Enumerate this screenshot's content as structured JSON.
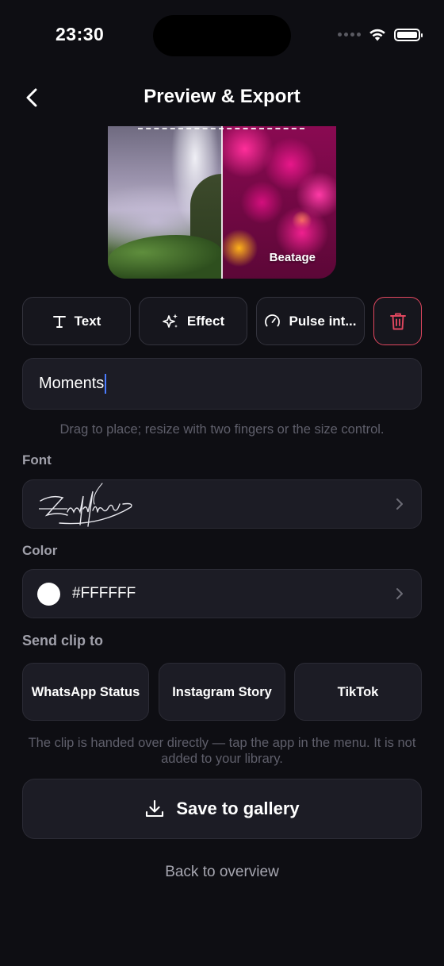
{
  "status_bar": {
    "time": "23:30"
  },
  "header": {
    "title": "Preview & Export"
  },
  "preview": {
    "watermark": "Beatage"
  },
  "tools": {
    "text_label": "Text",
    "effect_label": "Effect",
    "pulse_label": "Pulse int..."
  },
  "text_input": {
    "value": "Moments"
  },
  "text_hint": "Drag to place; resize with two fingers or the size control.",
  "font": {
    "label": "Font",
    "value": "Zapfino"
  },
  "color": {
    "label": "Color",
    "value": "#FFFFFF",
    "swatch": "#FFFFFF"
  },
  "send": {
    "label": "Send clip to",
    "targets": [
      "WhatsApp Status",
      "Instagram Story",
      "TikTok"
    ],
    "note": "The clip is handed over directly — tap the app in the menu. It is not added to your library."
  },
  "save_label": "Save to gallery",
  "back_label": "Back to overview",
  "colors": {
    "background": "#0e0e13",
    "card": "#1c1c25",
    "danger": "#e0475f",
    "caret": "#4a7bff"
  }
}
